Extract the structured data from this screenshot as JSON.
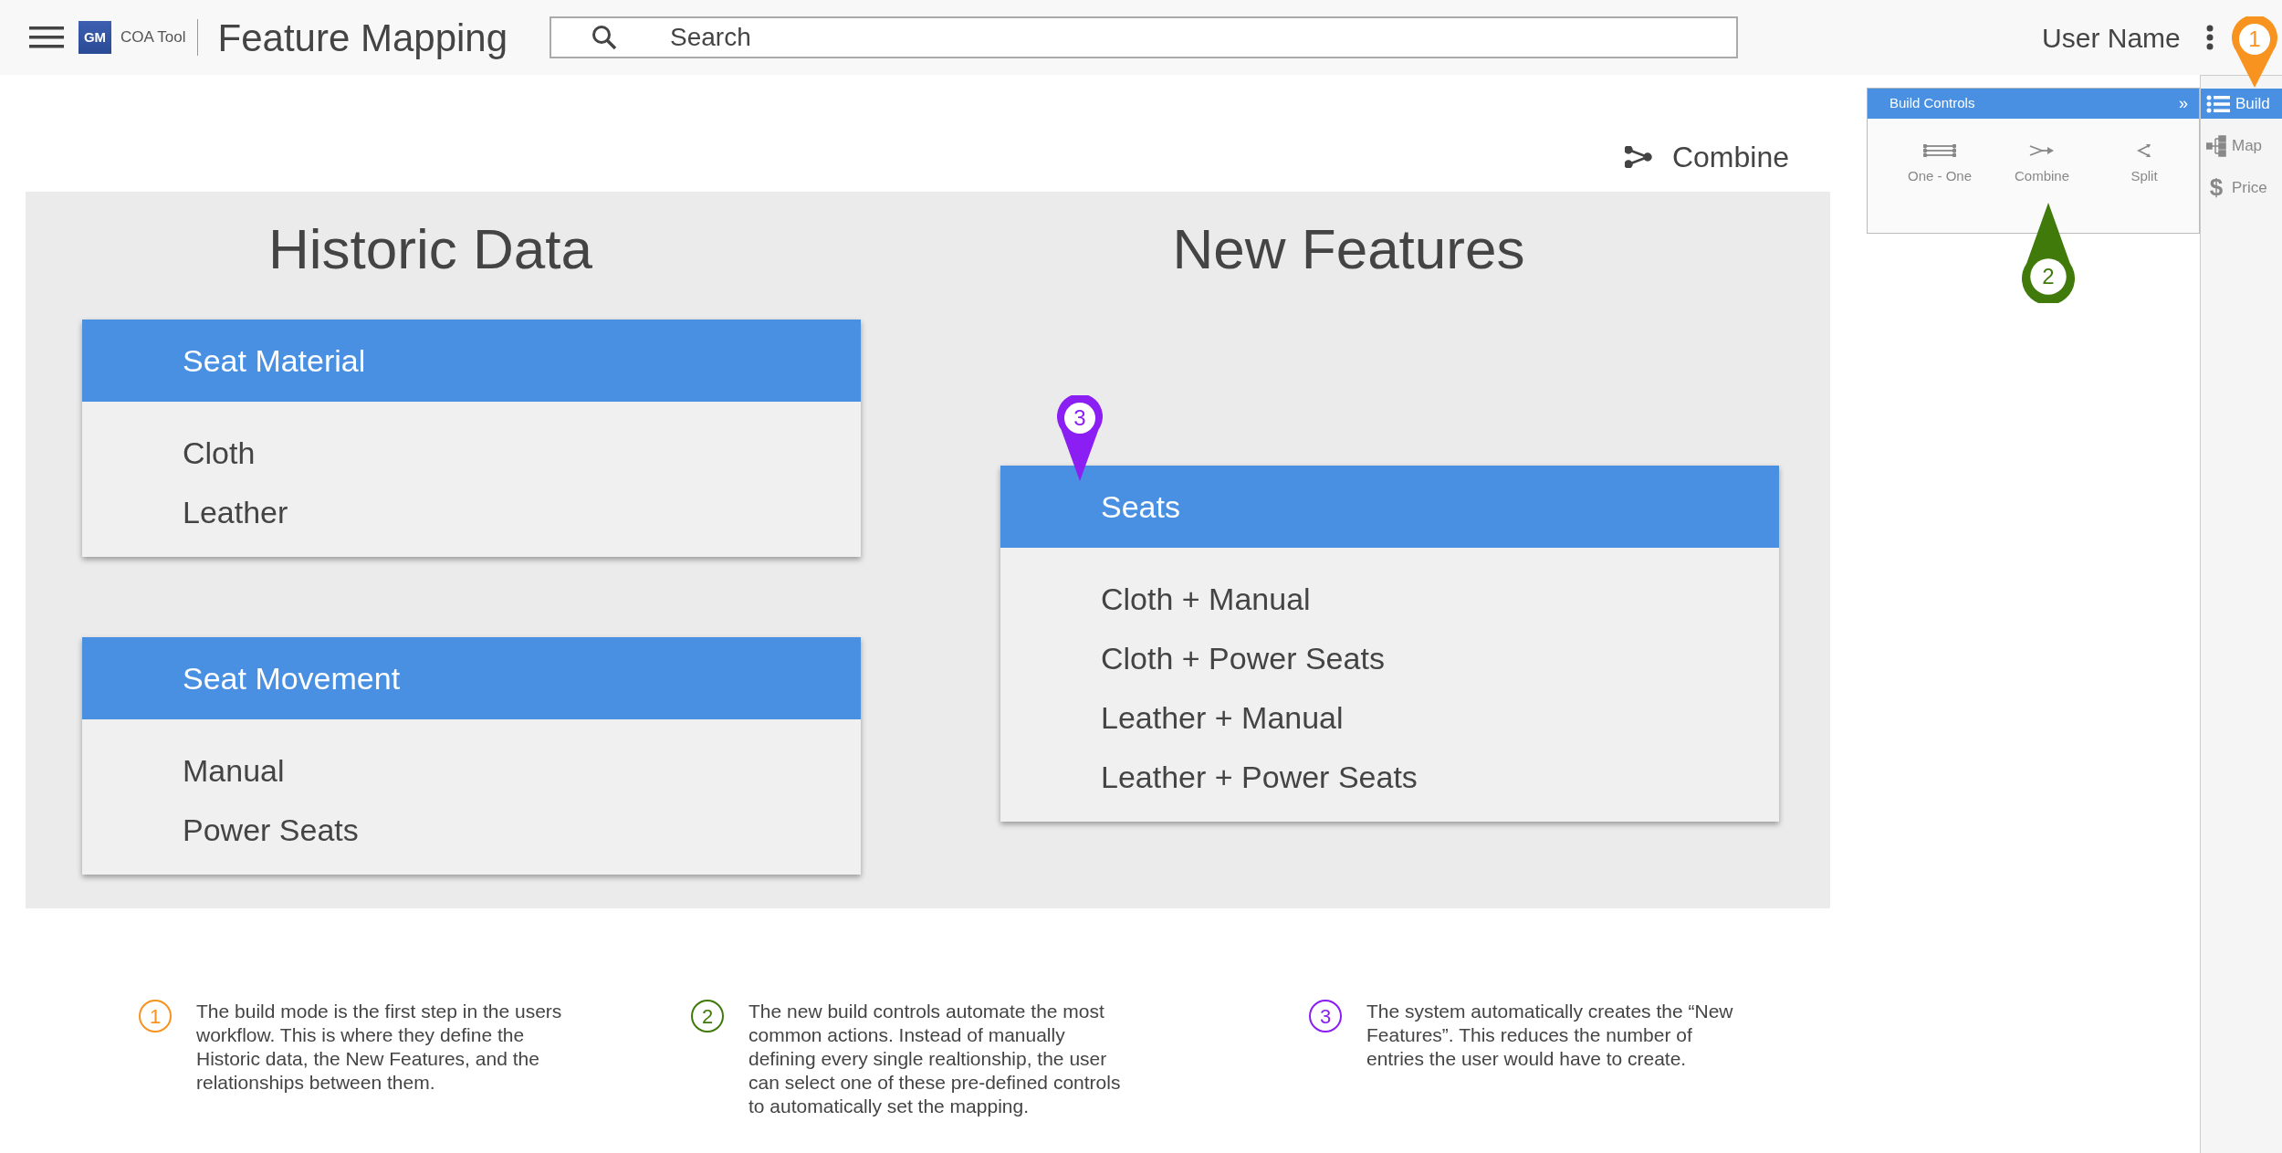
{
  "header": {
    "logo_text": "GM",
    "app_name": "COA Tool",
    "title": "Feature Mapping",
    "search": {
      "placeholder": "Search"
    },
    "user_name": "User Name"
  },
  "action": {
    "label": "Combine"
  },
  "columns": [
    {
      "title": "Historic Data",
      "groups": [
        {
          "name": "Seat Material",
          "items": [
            "Cloth",
            "Leather"
          ]
        },
        {
          "name": "Seat Movement",
          "items": [
            "Manual",
            "Power Seats"
          ]
        }
      ]
    },
    {
      "title": "New Features",
      "groups": [
        {
          "name": "Seats",
          "items": [
            "Cloth + Manual",
            "Cloth + Power Seats",
            "Leather + Manual",
            "Leather + Power Seats"
          ]
        }
      ]
    }
  ],
  "build_controls": {
    "title": "Build Controls",
    "collapse": "»",
    "items": [
      {
        "label": "One - One",
        "kind": "one-one"
      },
      {
        "label": "Combine",
        "kind": "combine"
      },
      {
        "label": "Split",
        "kind": "split"
      }
    ]
  },
  "sidebar": {
    "items": [
      {
        "label": "Build",
        "kind": "build",
        "selected": true
      },
      {
        "label": "Map",
        "kind": "map",
        "selected": false
      },
      {
        "label": "Price",
        "kind": "price",
        "symbol": "$",
        "selected": false
      }
    ]
  },
  "pins": [
    {
      "number": "1",
      "color": "#f7931e",
      "kind": "down"
    },
    {
      "number": "2",
      "color": "#3f7a0b",
      "kind": "up"
    },
    {
      "number": "3",
      "color": "#8b1ef2",
      "kind": "down"
    }
  ],
  "notes": [
    {
      "number": "1",
      "color": "#f7931e",
      "text": "The build mode is the first step in the users workflow. This is where they define the Historic data, the New Features, and the relationships between them."
    },
    {
      "number": "2",
      "color": "#3f7a0b",
      "text": "The new build controls automate the most common actions. Instead of manually defining every single realtionship, the user can select one of these pre-defined controls to automatically set the mapping."
    },
    {
      "number": "3",
      "color": "#8b1ef2",
      "text": "The system automatically creates the “New Features”. This reduces the number of entries the user would have to create."
    }
  ]
}
